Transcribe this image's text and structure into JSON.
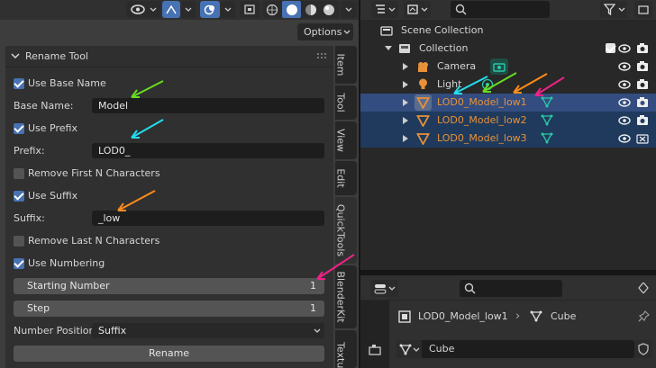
{
  "viewport": {
    "options_label": "Options",
    "panel": {
      "title": "Rename Tool",
      "use_base_name": "Use Base Name",
      "base_name_label": "Base Name:",
      "base_name_value": "Model",
      "use_prefix": "Use Prefix",
      "prefix_label": "Prefix:",
      "prefix_value": "LOD0_",
      "remove_first": "Remove First N Characters",
      "use_suffix": "Use Suffix",
      "suffix_label": "Suffix:",
      "suffix_value": "_low",
      "remove_last": "Remove Last N Characters",
      "use_numbering": "Use Numbering",
      "starting_number_label": "Starting Number",
      "starting_number_value": "1",
      "step_label": "Step",
      "step_value": "1",
      "number_position_label": "Number Position:",
      "number_position_value": "Suffix",
      "rename_button": "Rename"
    },
    "tabs": [
      "Item",
      "Tool",
      "View",
      "Edit",
      "QuickTools",
      "BlenderKit",
      "Textur"
    ]
  },
  "outliner": {
    "scene_collection": "Scene Collection",
    "collection": "Collection",
    "items": [
      {
        "name": "Camera",
        "color": "#d6d6d6"
      },
      {
        "name": "Light",
        "color": "#d6d6d6"
      },
      {
        "name": "LOD0_Model_low1",
        "color": "#e8913a"
      },
      {
        "name": "LOD0_Model_low2",
        "color": "#e8913a"
      },
      {
        "name": "LOD0_Model_low3",
        "color": "#e8913a"
      }
    ]
  },
  "properties": {
    "object_name": "LOD0_Model_low1",
    "separator": "›",
    "mesh_name": "Cube",
    "mesh_field_value": "Cube"
  },
  "colors": {
    "accent": "#4772b3",
    "selected_row": "#334d80",
    "object_orange": "#e8913a",
    "mesh_green": "#2bc8a6",
    "arrow_green": "#66dd22",
    "arrow_cyan": "#22ddee",
    "arrow_orange": "#ff8c1a",
    "arrow_pink": "#ee2288"
  }
}
